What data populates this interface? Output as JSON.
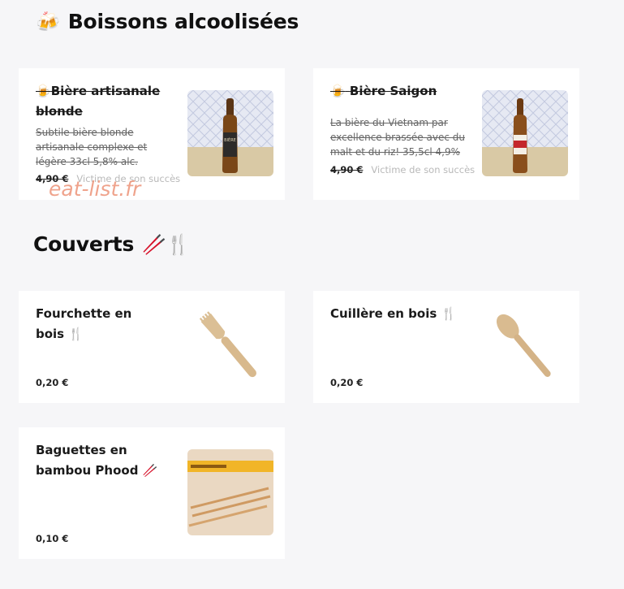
{
  "sections": [
    {
      "title": "Boissons alcoolisées",
      "icon": "beer-mug-icon",
      "emoji": "🍻"
    },
    {
      "title": "Couverts",
      "icon": "chopsticks-and-cutlery-icon",
      "emoji": "🥢🍴"
    }
  ],
  "products": [
    {
      "name": "Bière artisanale blonde",
      "emoji": "🍺",
      "description": "Subtile bière blonde artisanale complexe et légère 33cl 5,8% alc.",
      "price": "4,90 €",
      "status": "Victime de son succès",
      "image": "beer-bottle-image"
    },
    {
      "name": "Bière Saigon",
      "emoji": "🍺",
      "description": "La bière du Vietnam par excellence brassée avec du malt et du riz! 35,5cl 4,9%",
      "price": "4,90 €",
      "status": "Victime de son succès",
      "image": "saigon-beer-bottle-image"
    },
    {
      "name": "Fourchette en bois",
      "emoji": "🍴",
      "price": "0,20 €",
      "image": "wooden-fork-image"
    },
    {
      "name": "Cuillère en bois",
      "emoji": "🍴",
      "price": "0,20 €",
      "image": "wooden-spoon-image"
    },
    {
      "name": "Baguettes en bambou Phood",
      "emoji": "🥢",
      "price": "0,10 €",
      "image": "bamboo-chopsticks-image"
    }
  ],
  "watermark": "eat-list.fr",
  "colors": {
    "page_background": "#f6f6f8",
    "card_background": "#ffffff",
    "watermark": "#ee9a80",
    "status_text": "#b9b9b9"
  }
}
